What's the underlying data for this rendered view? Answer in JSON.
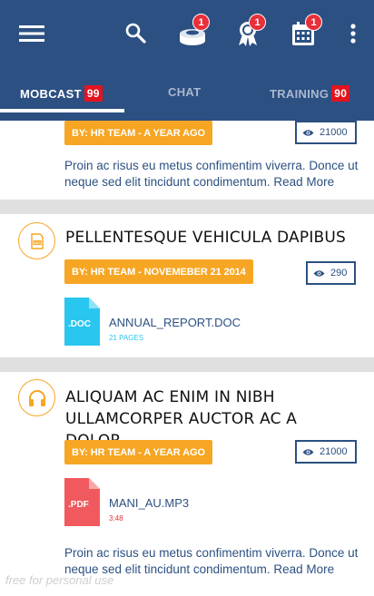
{
  "toolbar": {
    "menu_icon": "hamburger-menu-icon",
    "search_icon": "search-icon",
    "icons": [
      {
        "name": "event-icon",
        "badge": "1"
      },
      {
        "name": "award-icon",
        "badge": "1"
      },
      {
        "name": "calendar-icon",
        "badge": "1"
      }
    ],
    "overflow_icon": "more-vertical-icon"
  },
  "tabs": [
    {
      "label": "MOBCAST",
      "count": "99",
      "active": true
    },
    {
      "label": "CHAT",
      "count": "",
      "active": false
    },
    {
      "label": "TRAINING",
      "count": "90",
      "active": false
    }
  ],
  "posts": [
    {
      "byline": "BY: HR TEAM - A YEAR AGO",
      "views": "21000",
      "description": "Proin ac risus eu metus confimentim viverra. Donce ut neque sed elit tincidunt condimentum. Read More"
    },
    {
      "avatar_icon": "document-icon",
      "title": "PELLENTESQUE VEHICULA DAPIBUS",
      "byline": "BY: HR TEAM - NOVEMEBER 21 2014",
      "views": "290",
      "file": {
        "type_label": ".DOC",
        "name": "ANNUAL_REPORT.DOC",
        "meta": "21 PAGES",
        "color": "#29c6ef"
      }
    },
    {
      "avatar_icon": "headphones-icon",
      "title": "ALIQUAM AC ENIM IN NIBH ULLAMCORPER AUCTOR AC A DOLOR",
      "byline": "BY: HR TEAM - A YEAR AGO",
      "views": "21000",
      "file": {
        "type_label": ".PDF",
        "name": "MANI_AU.MP3",
        "meta": "3:48",
        "color": "#f0595d"
      },
      "description": "Proin ac risus eu metus confimentim viverra. Donce ut neque sed elit tincidunt condimentum. Read More"
    }
  ],
  "watermark": "free for personal use",
  "colors": {
    "primary": "#2c5082",
    "accent": "#f6a623",
    "badge": "#e8303a",
    "doc": "#29c6ef",
    "pdf": "#f0595d"
  }
}
